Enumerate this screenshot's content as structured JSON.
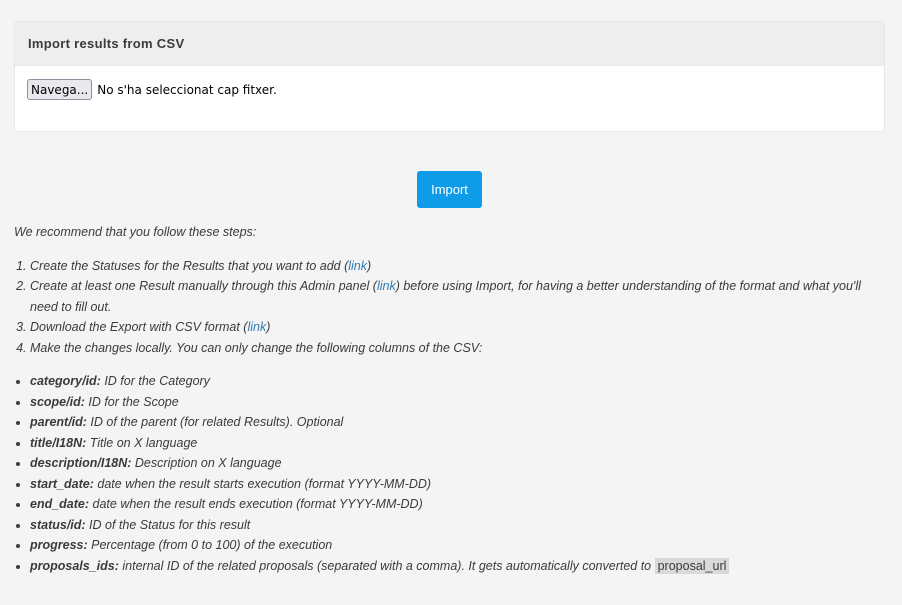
{
  "card": {
    "title": "Import results from CSV",
    "browse_label": "Navega...",
    "no_file_text": "No s'ha seleccionat cap fitxer."
  },
  "import_button": "Import",
  "intro": "We recommend that you follow these steps:",
  "steps": [
    {
      "before": "Create the Statuses for the Results that you want to add (",
      "link": "link",
      "after": ")"
    },
    {
      "before": "Create at least one Result manually through this Admin panel (",
      "link": "link",
      "after": ") before using Import, for having a better understanding of the format and what you'll need to fill out."
    },
    {
      "before": "Download the Export with CSV format (",
      "link": "link",
      "after": ")"
    },
    {
      "before": "Make the changes locally. You can only change the following columns of the CSV:",
      "link": "",
      "after": ""
    }
  ],
  "columns": [
    {
      "name": "category/id:",
      "desc": " ID for the Category"
    },
    {
      "name": "scope/id:",
      "desc": " ID for the Scope"
    },
    {
      "name": "parent/id:",
      "desc": " ID of the parent (for related Results). Optional"
    },
    {
      "name": "title/I18N:",
      "desc": " Title on X language"
    },
    {
      "name": "description/I18N:",
      "desc": " Description on X language"
    },
    {
      "name": "start_date:",
      "desc": " date when the result starts execution (format YYYY-MM-DD)"
    },
    {
      "name": "end_date:",
      "desc": " date when the result ends execution (format YYYY-MM-DD)"
    },
    {
      "name": "status/id:",
      "desc": " ID of the Status for this result"
    },
    {
      "name": "progress:",
      "desc": " Percentage (from 0 to 100) of the execution"
    },
    {
      "name": "proposals_ids:",
      "desc": " internal ID of the related proposals (separated with a comma). It gets automatically converted to "
    }
  ],
  "proposal_code": "proposal_url",
  "colors": {
    "primary_button": "#0e9ce8",
    "link": "#2d7bb0",
    "background": "#f4f4f4"
  }
}
